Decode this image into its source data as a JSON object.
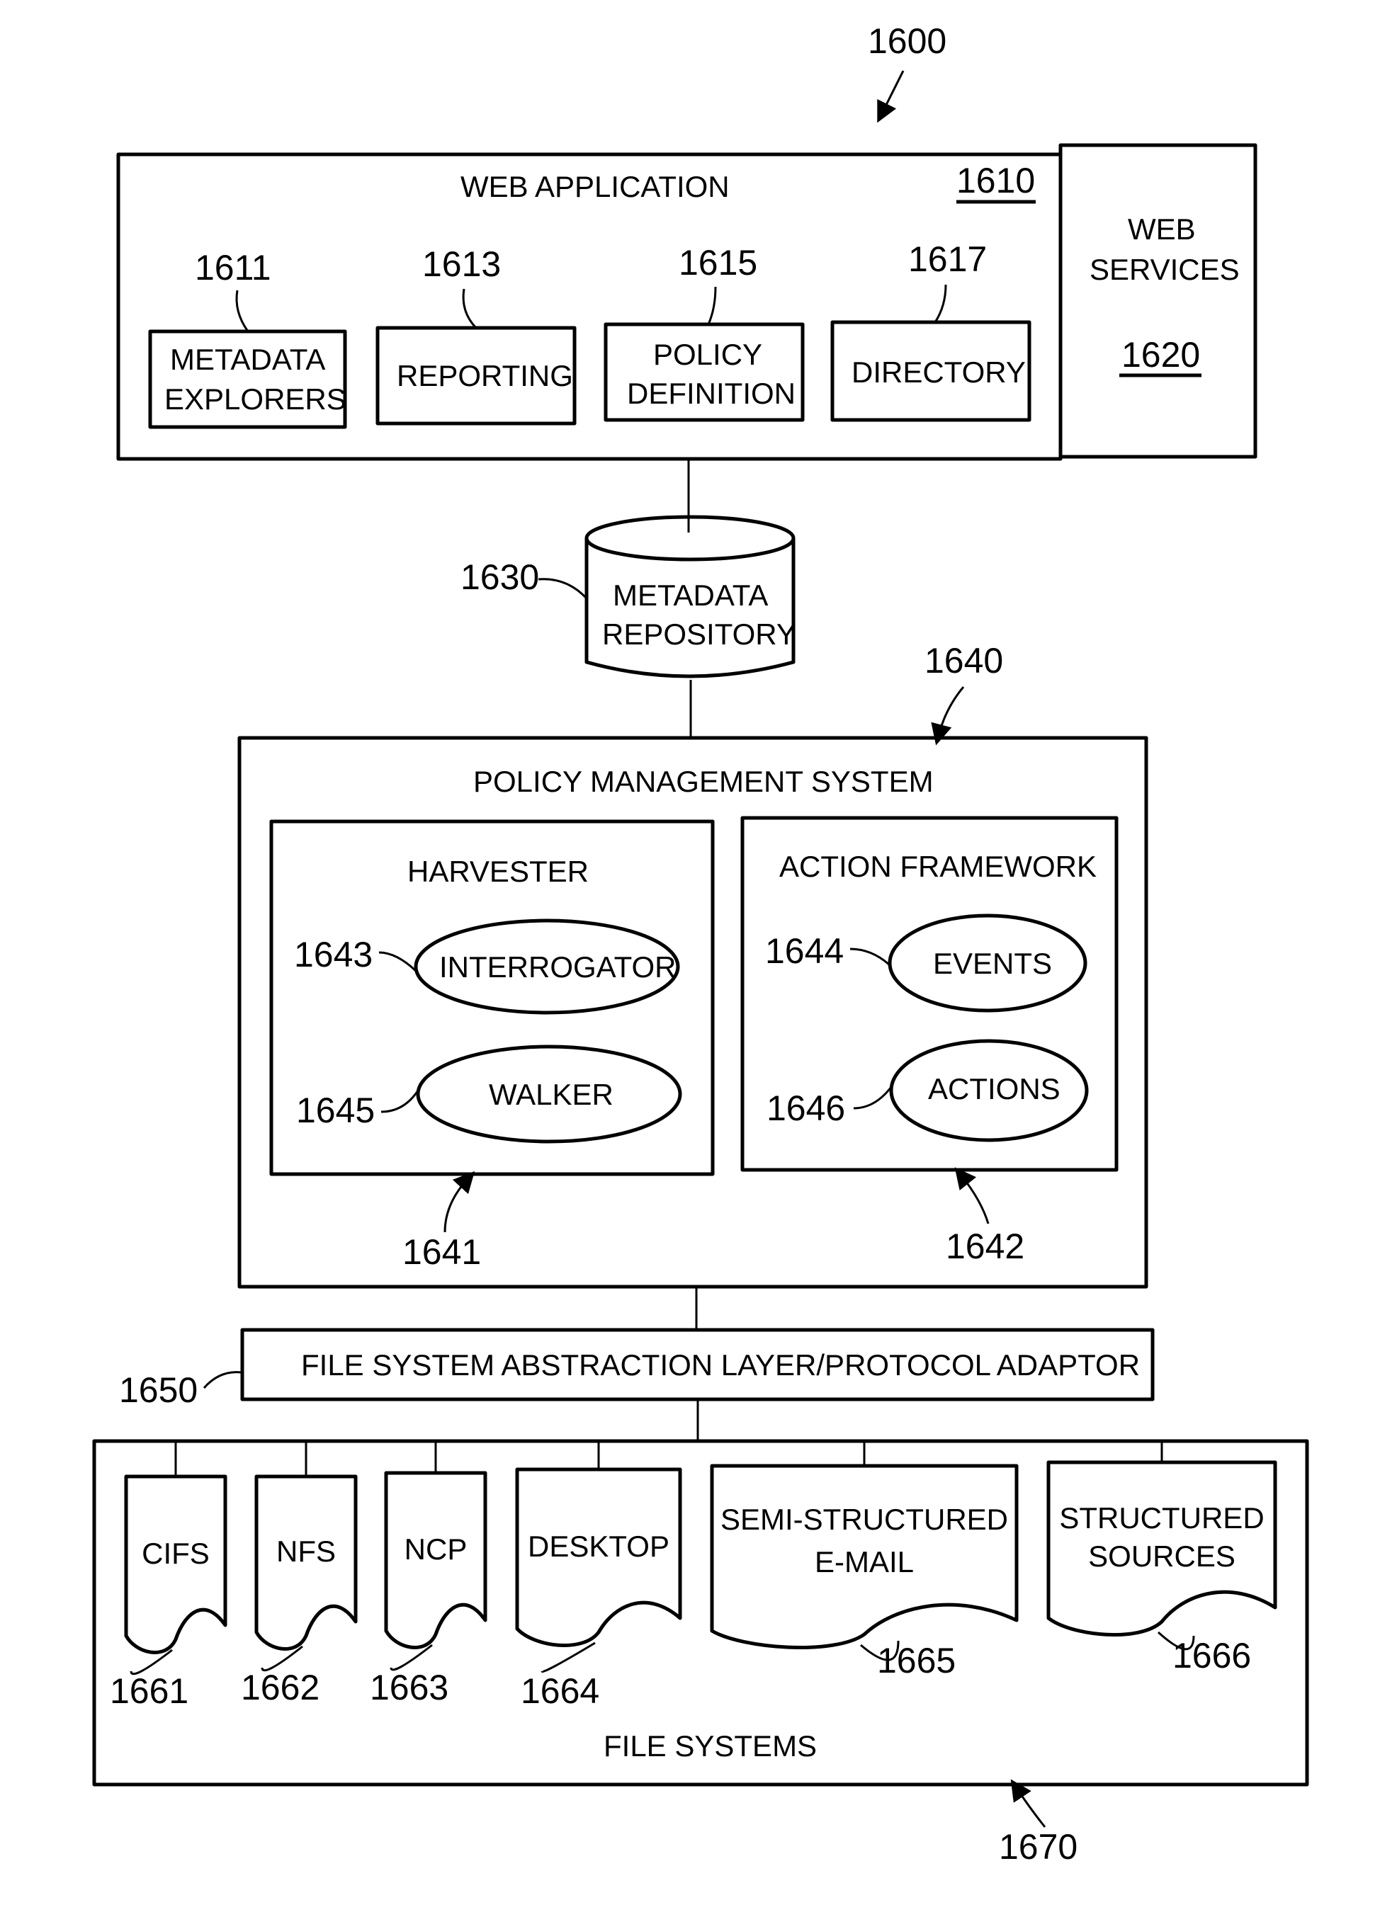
{
  "figure": {
    "ref": "1600",
    "web_application": {
      "title": "WEB APPLICATION",
      "ref": "1610",
      "modules": [
        {
          "ref": "1611",
          "lines": [
            "METADATA",
            "EXPLORERS"
          ]
        },
        {
          "ref": "1613",
          "lines": [
            "REPORTING"
          ]
        },
        {
          "ref": "1615",
          "lines": [
            "POLICY",
            "DEFINITION"
          ]
        },
        {
          "ref": "1617",
          "lines": [
            "DIRECTORY"
          ]
        }
      ]
    },
    "web_services": {
      "lines": [
        "WEB",
        "SERVICES"
      ],
      "ref": "1620"
    },
    "metadata_repository": {
      "lines": [
        "METADATA",
        "REPOSITORY"
      ],
      "ref": "1630"
    },
    "policy_management": {
      "title": "POLICY MANAGEMENT SYSTEM",
      "ref": "1640",
      "harvester": {
        "title": "HARVESTER",
        "ref": "1641",
        "items": [
          {
            "label": "INTERROGATOR",
            "ref": "1643"
          },
          {
            "label": "WALKER",
            "ref": "1645"
          }
        ]
      },
      "action_framework": {
        "title": "ACTION FRAMEWORK",
        "ref": "1642",
        "items": [
          {
            "label": "EVENTS",
            "ref": "1644"
          },
          {
            "label": "ACTIONS",
            "ref": "1646"
          }
        ]
      }
    },
    "abstraction_layer": {
      "label": "FILE SYSTEM ABSTRACTION LAYER/PROTOCOL ADAPTOR",
      "ref": "1650"
    },
    "file_systems": {
      "title": "FILE SYSTEMS",
      "ref": "1670",
      "sources": [
        {
          "ref": "1661",
          "lines": [
            "CIFS"
          ]
        },
        {
          "ref": "1662",
          "lines": [
            "NFS"
          ]
        },
        {
          "ref": "1663",
          "lines": [
            "NCP"
          ]
        },
        {
          "ref": "1664",
          "lines": [
            "DESKTOP"
          ]
        },
        {
          "ref": "1665",
          "lines": [
            "SEMI-STRUCTURED",
            "E-MAIL"
          ]
        },
        {
          "ref": "1666",
          "lines": [
            "STRUCTURED",
            "SOURCES"
          ]
        }
      ]
    }
  }
}
